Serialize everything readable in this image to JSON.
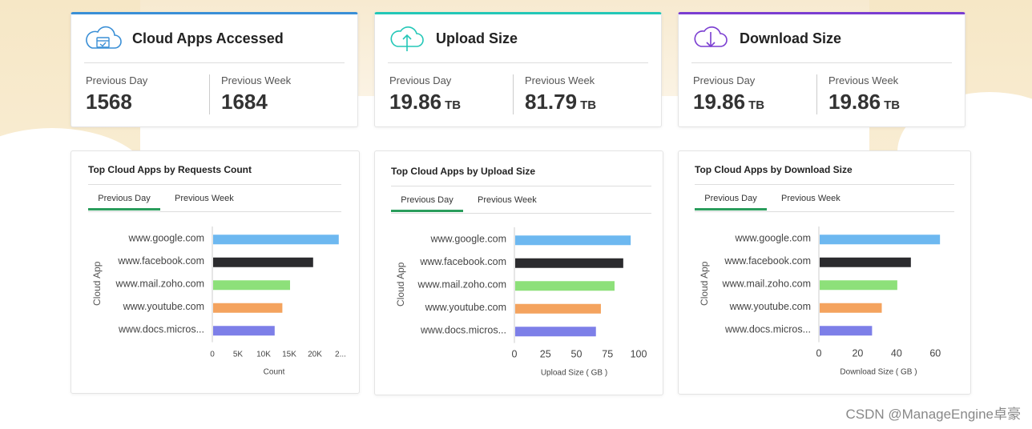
{
  "colors": {
    "accounts_top": "#3a8fd6",
    "upload_top": "#23c7b7",
    "download_top": "#7a3dd1",
    "tab_active": "#2a9d5c",
    "bars": [
      "#6db8f0",
      "#2b2b2e",
      "#8de07a",
      "#f4a35e",
      "#7d7fe8"
    ]
  },
  "summary": [
    {
      "icon": "cloud-calendar-icon",
      "title": "Cloud Apps Accessed",
      "prev_day_label": "Previous Day",
      "prev_day_value": "1568",
      "prev_day_unit": "",
      "prev_week_label": "Previous Week",
      "prev_week_value": "1684",
      "prev_week_unit": ""
    },
    {
      "icon": "cloud-upload-icon",
      "title": "Upload Size",
      "prev_day_label": "Previous Day",
      "prev_day_value": "19.86",
      "prev_day_unit": "TB",
      "prev_week_label": "Previous Week",
      "prev_week_value": "81.79",
      "prev_week_unit": "TB"
    },
    {
      "icon": "cloud-download-icon",
      "title": "Download Size",
      "prev_day_label": "Previous Day",
      "prev_day_value": "19.86",
      "prev_day_unit": "TB",
      "prev_week_label": "Previous Week",
      "prev_week_value": "19.86",
      "prev_week_unit": "TB"
    }
  ],
  "charts": [
    {
      "title": "Top Cloud Apps by Requests Count",
      "tab_active": "Previous Day",
      "tab_inactive": "Previous Week"
    },
    {
      "title": "Top Cloud Apps by Upload Size",
      "tab_active": "Previous Day",
      "tab_inactive": "Previous Week"
    },
    {
      "title": "Top Cloud Apps by Download Size",
      "tab_active": "Previous Day",
      "tab_inactive": "Previous Week"
    }
  ],
  "chart_data": [
    {
      "type": "bar",
      "orientation": "horizontal",
      "title": "Top Cloud Apps by Requests Count",
      "categories": [
        "www.google.com",
        "www.facebook.com",
        "www.mail.zoho.com",
        "www.youtube.com",
        "www.docs.micros..."
      ],
      "values": [
        24500,
        19500,
        15000,
        13500,
        12000
      ],
      "xlabel": "Count",
      "ylabel": "Cloud App",
      "xticks": [
        "0",
        "5K",
        "10K",
        "15K",
        "20K",
        "2..."
      ],
      "xlim": [
        0,
        25000
      ]
    },
    {
      "type": "bar",
      "orientation": "horizontal",
      "title": "Top Cloud Apps by Upload Size",
      "categories": [
        "www.google.com",
        "www.facebook.com",
        "www.mail.zoho.com",
        "www.youtube.com",
        "www.docs.micros..."
      ],
      "values": [
        93,
        87,
        80,
        69,
        65
      ],
      "xlabel": "Upload Size ( GB )",
      "ylabel": "Cloud App",
      "xticks": [
        "0",
        "25",
        "50",
        "75",
        "100"
      ],
      "xlim": [
        0,
        100
      ]
    },
    {
      "type": "bar",
      "orientation": "horizontal",
      "title": "Top Cloud Apps by Download Size",
      "categories": [
        "www.google.com",
        "www.facebook.com",
        "www.mail.zoho.com",
        "www.youtube.com",
        "www.docs.micros..."
      ],
      "values": [
        62,
        47,
        40,
        32,
        27
      ],
      "xlabel": "Download Size ( GB )",
      "ylabel": "Cloud App",
      "xticks": [
        "0",
        "20",
        "40",
        "60"
      ],
      "xlim": [
        0,
        64
      ]
    }
  ],
  "watermark": "CSDN @ManageEngine卓豪"
}
